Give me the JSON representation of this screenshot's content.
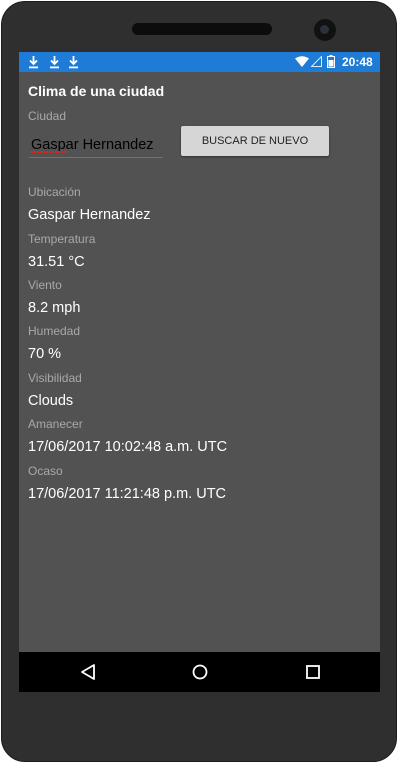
{
  "status_bar": {
    "time": "20:48",
    "notification_icons": [
      "download-icon",
      "download-icon",
      "download-icon"
    ],
    "system_icons": [
      "wifi-icon",
      "signal-icon",
      "battery-icon"
    ],
    "color": "#1e7bd6"
  },
  "app": {
    "title": "Clima de una ciudad",
    "city_label": "Ciudad",
    "city_value": "Gaspar Hernandez",
    "search_button": "BUSCAR DE NUEVO"
  },
  "weather": {
    "location_label": "Ubicación",
    "location_value": "Gaspar Hernandez",
    "temperature_label": "Temperatura",
    "temperature_value": "31.51 °C",
    "wind_label": "Viento",
    "wind_value": "8.2 mph",
    "humidity_label": "Humedad",
    "humidity_value": "70 %",
    "visibility_label": "Visibilidad",
    "visibility_value": "Clouds",
    "sunrise_label": "Amanecer",
    "sunrise_value": "17/06/2017 10:02:48 a.m. UTC",
    "sunset_label": "Ocaso",
    "sunset_value": "17/06/2017 11:21:48 p.m. UTC"
  },
  "navigation": {
    "buttons": [
      "back-icon",
      "home-icon",
      "recents-icon"
    ]
  }
}
